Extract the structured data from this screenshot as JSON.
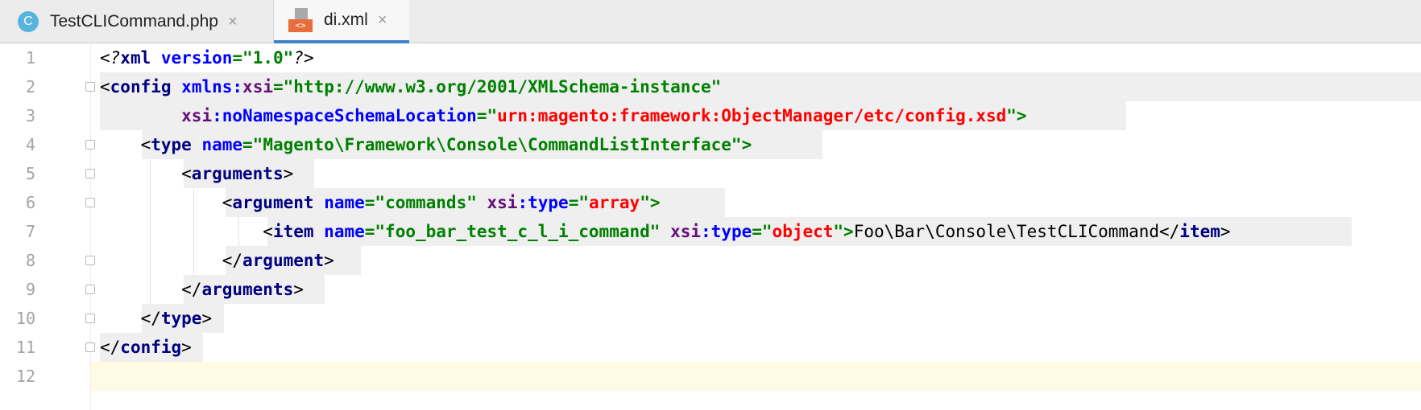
{
  "tabs": [
    {
      "label": "TestCLICommand.php",
      "badge": "C",
      "active": false
    },
    {
      "label": "di.xml",
      "badge": "<>",
      "active": true
    }
  ],
  "tab_close_glyph": "×",
  "colors": {
    "active_tab_underline": "#4083c9",
    "php_badge": "#58b4de",
    "xml_badge": "#e76d3b",
    "current_line": "#fffae3"
  },
  "editor": {
    "current_line": 12,
    "line_numbers": [
      "1",
      "2",
      "3",
      "4",
      "5",
      "6",
      "7",
      "8",
      "9",
      "10",
      "11",
      "12"
    ],
    "lines": {
      "l1": {
        "a": "<?",
        "b": "xml",
        "c": " ",
        "d": "version",
        "e": "=\"",
        "f": "1.0",
        "g": "\"",
        "h": "?>"
      },
      "l2": {
        "a": "<",
        "b": "config",
        "c": " ",
        "d": "xmlns",
        "e": ":",
        "f": "xsi",
        "g": "=\"",
        "h": "http://www.w3.org/2001/XMLSchema-instance",
        "i": "\""
      },
      "l3": {
        "a": "        ",
        "b": "xsi",
        "c": ":",
        "d": "noNamespaceSchemaLocation",
        "e": "=\"",
        "f": "urn:magento:framework:ObjectManager/etc/config.xsd",
        "g": "\">"
      },
      "l4": {
        "a": "    <",
        "b": "type",
        "c": " ",
        "d": "name",
        "e": "=\"",
        "f": "Magento\\Framework\\Console\\CommandListInterface",
        "g": "\">"
      },
      "l5": {
        "a": "        <",
        "b": "arguments",
        "c": ">"
      },
      "l6": {
        "a": "            <",
        "b": "argument",
        "c": " ",
        "d": "name",
        "e": "=\"",
        "f": "commands",
        "g": "\" ",
        "h": "xsi",
        "i": ":",
        "j": "type",
        "k": "=\"",
        "l": "array",
        "m": "\">"
      },
      "l7": {
        "a": "                <",
        "b": "item",
        "c": " ",
        "d": "name",
        "e": "=\"",
        "f": "foo_bar_test_c_l_i_command",
        "g": "\" ",
        "h": "xsi",
        "i": ":",
        "j": "type",
        "k": "=\"",
        "l": "object",
        "m": "\">",
        "n": "Foo\\Bar\\Console\\TestCLICommand",
        "o": "</",
        "p": "item",
        "q": ">"
      },
      "l8": {
        "a": "            </",
        "b": "argument",
        "c": ">"
      },
      "l9": {
        "a": "        </",
        "b": "arguments",
        "c": ">"
      },
      "l10": {
        "a": "    </",
        "b": "type",
        "c": ">"
      },
      "l11": {
        "a": "</",
        "b": "config",
        "c": ">"
      }
    }
  }
}
